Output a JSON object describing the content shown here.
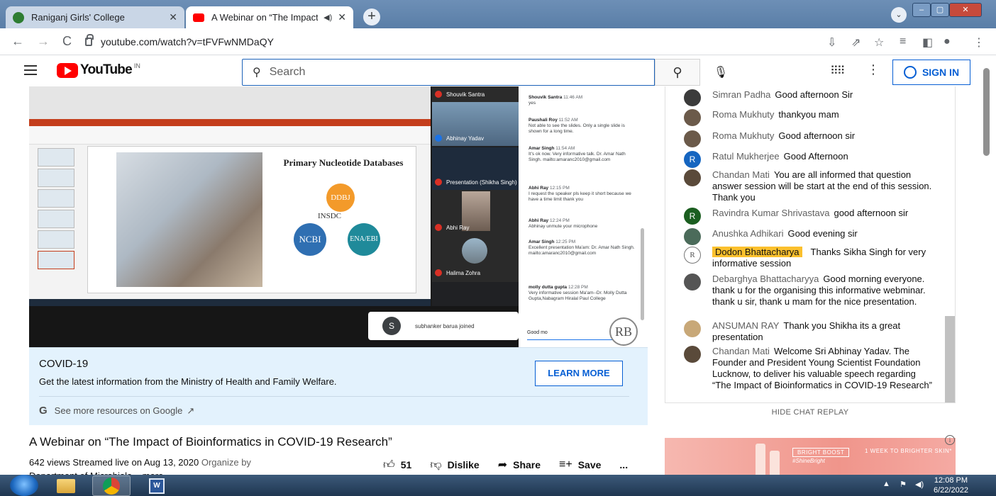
{
  "browser": {
    "tabs": [
      {
        "title": "Raniganj Girls' College",
        "active": false
      },
      {
        "title": "A Webinar on “The Impact of",
        "active": true
      }
    ],
    "url": "youtube.com/watch?v=tFVFwNMDaQY"
  },
  "youtube": {
    "logo_text": "YouTube",
    "region": "IN",
    "search_placeholder": "Search",
    "sign_in_label": "SIGN IN"
  },
  "video_frame": {
    "slide_title": "Primary Nucleotide Databases",
    "databases": [
      "DDBJ",
      "INSDC",
      "NCBI",
      "ENA/EBI"
    ],
    "participants": [
      "Shouvik Santra",
      "Abhinay Yadav",
      "Presentation (Shikha Singh)",
      "Abhi Ray",
      "Halima Zohra"
    ],
    "join_toast": {
      "initial": "S",
      "text": "subhanker barua joined"
    },
    "meet_chat": [
      {
        "name": "Shouvik Santra",
        "time": "11:46 AM",
        "text": "yes"
      },
      {
        "name": "Paushali Roy",
        "time": "11:52 AM",
        "text": "Not able to see the slides. Only a single slide is shown for a long time."
      },
      {
        "name": "Amar Singh",
        "time": "11:54 AM",
        "text": "It's ok now. Very informative talk. Dr. Amar Nath Singh. mailto:amaranc2010@gmail.com"
      },
      {
        "name": "Abhi Ray",
        "time": "12:15 PM",
        "text": "I request the speaker pls keep it short because we have a time limit thank you"
      },
      {
        "name": "Abhi Ray",
        "time": "12:24 PM",
        "text": "Abhinay unmute your microphone"
      },
      {
        "name": "Amar Singh",
        "time": "12:25 PM",
        "text": "Excellent presentation Ma'am: Dr. Amar Nath Singh. mailto:amaranc2010@gmail.com"
      },
      {
        "name": "molly dutta gupta",
        "time": "12:28 PM",
        "text": "Very informative session Ma'am--Dr. Molly Dutta Gupta,Nabagram Hiralal Paul College"
      }
    ],
    "meet_chat_input": "Good mo",
    "watermark": "RB"
  },
  "info_panel": {
    "title": "COVID-19",
    "description": "Get the latest information from the Ministry of Health and Family Welfare.",
    "button": "LEARN MORE",
    "google_link": "See more resources on Google"
  },
  "video": {
    "title": "A Webinar on “The Impact of Bioinformatics in COVID-19 Research”",
    "meta": "642 views  Streamed live on Aug 13, 2020",
    "organizer": "Organize by",
    "meta2": "Department of Microbiolo...  more",
    "likes": "51",
    "dislike_label": "Dislike",
    "share_label": "Share",
    "save_label": "Save",
    "more_label": "..."
  },
  "chat": {
    "messages": [
      {
        "author": "Simran Padha",
        "text": "Good afternoon Sir",
        "avatar_color": "#3b3b3b"
      },
      {
        "author": "Roma Mukhuty",
        "text": "thankyou mam",
        "avatar_color": "#6b5a4a"
      },
      {
        "author": "Roma Mukhuty",
        "text": "Good afternoon sir",
        "avatar_color": "#6b5a4a"
      },
      {
        "author": "Ratul Mukherjee",
        "text": "Good Afternoon",
        "avatar_color": "#1565c0",
        "initial": "R"
      },
      {
        "author": "Chandan Mati",
        "text": "You are all informed that question answer session will be start at the end of this session. Thank you",
        "avatar_color": "#5a4a3a"
      },
      {
        "author": "Ravindra Kumar Shrivastava",
        "text": "good afternoon sir",
        "avatar_color": "#1b5e20",
        "initial": "R"
      },
      {
        "author": "Anushka Adhikari",
        "text": "Good evening sir",
        "avatar_color": "#4b6b5a"
      },
      {
        "author": "Dodon Bhattacharya",
        "text": "Thanks Sikha Singh for very informative session",
        "avatar_color": "#ffffff",
        "highlight": true
      },
      {
        "author": "Debarghya Bhattacharyya",
        "text": "Good morning everyone. thank u for the organising this informative webminar. thank u sir, thank u mam for the nice presentation.",
        "avatar_color": "#555555"
      },
      {
        "author": "ANSUMAN RAY",
        "text": "Thank you Shikha its a great presentation",
        "avatar_color": "#c8a878"
      },
      {
        "author": "Chandan Mati",
        "text": "Welcome Sri Abhinay Yadav. The Founder and President Young Scientist Foundation Lucknow, to deliver his valuable speech regarding “The Impact of Bioinformatics in COVID-19 Research”",
        "avatar_color": "#5a4a3a"
      }
    ],
    "hide_label": "HIDE CHAT REPLAY"
  },
  "ad": {
    "badge": "BRIGHT BOOST",
    "tag": "#ShineBright",
    "promo": "1 WEEK TO BRIGHTER SKIN*"
  },
  "taskbar": {
    "time": "12:08 PM",
    "date": "6/22/2022"
  }
}
